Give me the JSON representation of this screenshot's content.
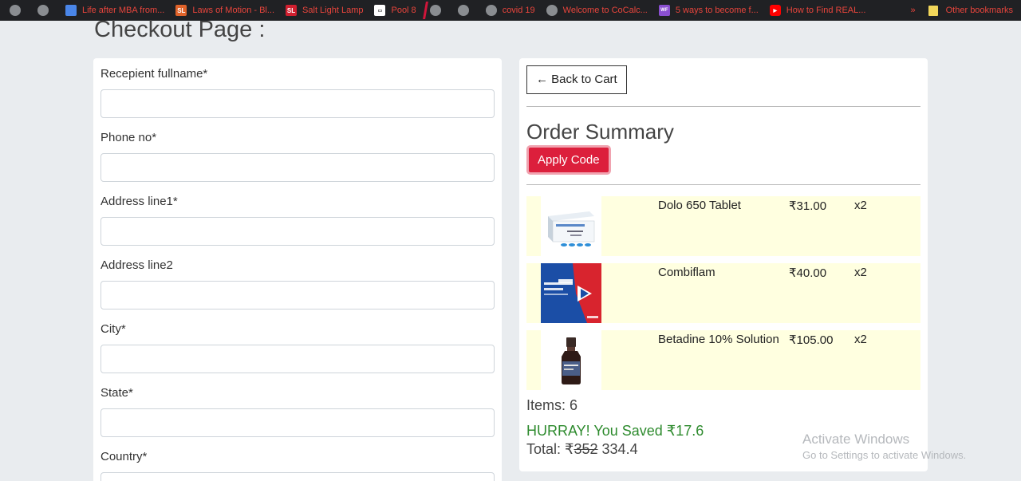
{
  "bookmarks": [
    {
      "label": "",
      "icon": "globe-icon"
    },
    {
      "label": "",
      "icon": "globe-icon"
    },
    {
      "label": "Life after MBA from...",
      "icon": "google-docs-icon",
      "color": "#4a86e8"
    },
    {
      "label": "Laws of Motion - Bl...",
      "icon": "SL",
      "color": "#e0632a"
    },
    {
      "label": "Salt Light Lamp",
      "icon": "SL",
      "color": "#d11f2f"
    },
    {
      "label": "Pool 8",
      "icon": "pool-icon",
      "color": "#ffffff"
    },
    {
      "label": "",
      "icon": "globe-icon"
    },
    {
      "label": "",
      "icon": "globe-icon"
    },
    {
      "label": "covid 19",
      "icon": "globe-icon"
    },
    {
      "label": "Welcome to CoCalc...",
      "icon": "globe-icon"
    },
    {
      "label": "5 ways to become f...",
      "icon": "WF",
      "color": "#8a4fd0"
    },
    {
      "label": "How to Find REAL...",
      "icon": "youtube-icon",
      "color": "#ff0000"
    }
  ],
  "bookmarks_more": "»",
  "other_bookmarks": "Other bookmarks",
  "page_title": "Checkout Page :",
  "form": {
    "fields": [
      {
        "label": "Recepient fullname*",
        "value": ""
      },
      {
        "label": "Phone no*",
        "value": ""
      },
      {
        "label": "Address line1*",
        "value": ""
      },
      {
        "label": "Address line2",
        "value": ""
      },
      {
        "label": "City*",
        "value": ""
      },
      {
        "label": "State*",
        "value": ""
      },
      {
        "label": "Country*",
        "value": ""
      }
    ]
  },
  "summary": {
    "back_label": "← Back to Cart",
    "title": "Order Summary",
    "apply_label": "Apply Code",
    "items": [
      {
        "name": "Dolo 650 Tablet",
        "price": "₹31.00",
        "qty": "x2",
        "thumb": "tablet-box-image"
      },
      {
        "name": "Combiflam",
        "price": "₹40.00",
        "qty": "x2",
        "thumb": "combiflam-box-image"
      },
      {
        "name": "Betadine 10% Solution",
        "price": "₹105.00",
        "qty": "x2",
        "thumb": "bottle-image"
      }
    ],
    "items_count": "Items: 6",
    "saved": "HURRAY! You Saved ₹17.6",
    "total_label": "Total: ₹",
    "total_original": "352",
    "total_final": " 334.4"
  },
  "watermark": {
    "line1": "Activate Windows",
    "line2": "Go to Settings to activate Windows."
  },
  "colors": {
    "accent": "#dc1f3c",
    "saved": "#2e8b2e",
    "item_bg": "#ffffe0",
    "page_bg": "#e9ecef"
  }
}
